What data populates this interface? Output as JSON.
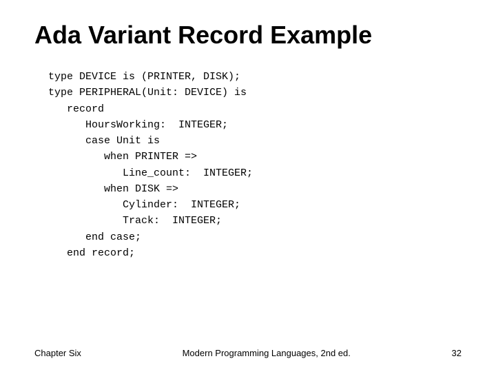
{
  "slide": {
    "title": "Ada Variant Record Example",
    "code": {
      "lines": [
        "type DEVICE is (PRINTER, DISK);",
        "",
        "type PERIPHERAL(Unit: DEVICE) is",
        "   record",
        "      HoursWorking:  INTEGER;",
        "      case Unit is",
        "         when PRINTER =>",
        "            Line_count:  INTEGER;",
        "         when DISK =>",
        "            Cylinder:  INTEGER;",
        "            Track:  INTEGER;",
        "      end case;",
        "   end record;"
      ]
    },
    "footer": {
      "left": "Chapter Six",
      "center": "Modern Programming Languages, 2nd ed.",
      "right": "32"
    }
  }
}
